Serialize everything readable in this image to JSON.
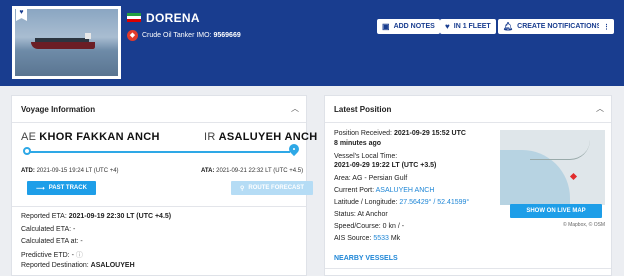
{
  "vessel": {
    "name": "DORENA",
    "type": "Crude Oil Tanker",
    "imo_label": "IMO:",
    "imo": "9569669"
  },
  "header_buttons": {
    "add_notes": "ADD NOTES",
    "fleet": "IN 1 FLEET",
    "notifications": "CREATE NOTIFICATIONS"
  },
  "voyage": {
    "title": "Voyage Information",
    "departure": {
      "country_code": "AE",
      "port": "KHOR FAKKAN ANCH"
    },
    "arrival": {
      "country_code": "IR",
      "port": "ASALUYEH ANCH"
    },
    "atd_label": "ATD:",
    "atd": "2021-09-15 19:24 LT (UTC +4)",
    "ata_label": "ATA:",
    "ata": "2021-09-21 22:32 LT (UTC +4.5)",
    "past_track": "PAST TRACK",
    "route_forecast": "ROUTE FORECAST",
    "reported_eta_label": "Reported ETA:",
    "reported_eta": "2021-09-19 22:30 LT (UTC +4.5)",
    "calculated_eta_label": "Calculated ETA:",
    "calculated_eta": "-",
    "calculated_eta_at_label": "Calculated ETA at:",
    "calculated_eta_at": "-",
    "predictive_etd_label": "Predictive ETD:",
    "predictive_etd": "-",
    "reported_destination_label": "Reported Destination:",
    "reported_destination": "ASALOUYEH"
  },
  "position": {
    "title": "Latest Position",
    "received_label": "Position Received:",
    "received": "2021-09-29 15:52 UTC",
    "ago": "8 minutes ago",
    "local_time_label": "Vessel's Local Time:",
    "local_time": "2021-09-29 19:22 LT (UTC +3.5)",
    "area_label": "Area:",
    "area": "AG - Persian Gulf",
    "current_port_label": "Current Port:",
    "current_port": "ASALUYEH ANCH",
    "latlon_label": "Latitude / Longitude:",
    "latlon": "27.56429° / 52.41599°",
    "status_label": "Status:",
    "status": "At Anchor",
    "speed_label": "Speed/Course:",
    "speed": "0 kn / -",
    "ais_label": "AIS Source:",
    "ais_source_id": "5533",
    "ais_source_suffix": "Mk",
    "show_on_map": "SHOW ON LIVE MAP",
    "map_attribution": "© Mapbox, © OSM",
    "nearby": "NEARBY VESSELS"
  },
  "colors": {
    "header_bg": "#193d8f",
    "accent": "#1e9ee8",
    "link": "#1e86d6"
  }
}
